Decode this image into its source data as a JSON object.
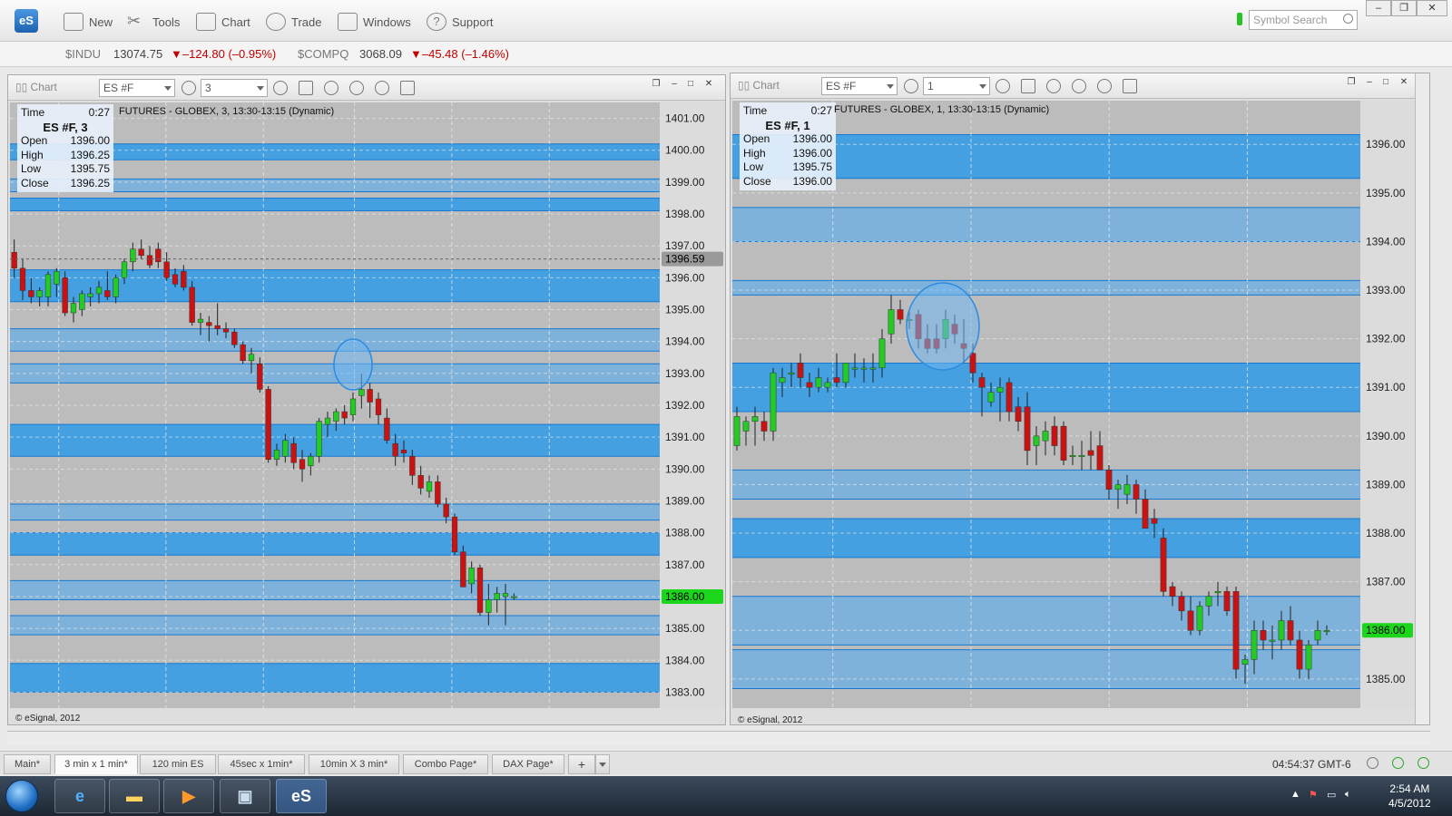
{
  "app": {
    "logo": "eS",
    "toolbar": [
      {
        "label": "New",
        "icon": "new-window-icon"
      },
      {
        "label": "Tools",
        "icon": "tools-icon"
      },
      {
        "label": "Chart",
        "icon": "chart-icon"
      },
      {
        "label": "Trade",
        "icon": "trade-icon"
      },
      {
        "label": "Windows",
        "icon": "windows-icon"
      },
      {
        "label": "Support",
        "icon": "help-icon"
      }
    ],
    "symbol_search_placeholder": "Symbol Search",
    "window_controls": [
      "–",
      "❐",
      "✕"
    ]
  },
  "ticker": [
    {
      "symbol": "$INDU",
      "value": "13074.75",
      "change": "▼–124.80 (–0.95%)"
    },
    {
      "symbol": "$COMPQ",
      "value": "3068.09",
      "change": "▼–45.48 (–1.46%)"
    }
  ],
  "colors": {
    "up": "#22cc22",
    "down": "#cc1111",
    "band_dark": "#2f9be6",
    "band_light": "#74b0df",
    "bg": "#bcbcbc",
    "last_price_bg": "#1cd61c"
  },
  "panes": [
    {
      "title": "Chart",
      "symbol": "ES #F",
      "interval": "3",
      "subtitle": "FUTURES - GLOBEX, 3, 13:30-13:15 (Dynamic)",
      "info": {
        "time_label": "Time",
        "time": "0:27",
        "header": "ES #F, 3",
        "rows": [
          [
            "Open",
            "1396.00"
          ],
          [
            "High",
            "1396.25"
          ],
          [
            "Low",
            "1395.75"
          ],
          [
            "Close",
            "1396.25"
          ]
        ]
      },
      "copyright": "© eSignal, 2012",
      "axis_labels": [
        "1401.00",
        "1400.00",
        "1399.00",
        "1398.00",
        "1397.00",
        "1396.00",
        "1395.00",
        "1394.00",
        "1393.00",
        "1392.00",
        "1391.00",
        "1390.00",
        "1389.00",
        "1388.00",
        "1387.00",
        "1386.00",
        "1385.00",
        "1384.00",
        "1383.00"
      ],
      "marker_label": "1396.59",
      "last_price": "1386.00"
    },
    {
      "title": "Chart",
      "symbol": "ES #F",
      "interval": "1",
      "subtitle": "FUTURES - GLOBEX, 1, 13:30-13:15 (Dynamic)",
      "info": {
        "time_label": "Time",
        "time": "0:27",
        "header": "ES #F, 1",
        "rows": [
          [
            "Open",
            "1396.00"
          ],
          [
            "High",
            "1396.00"
          ],
          [
            "Low",
            "1395.75"
          ],
          [
            "Close",
            "1396.00"
          ]
        ]
      },
      "copyright": "© eSignal, 2012",
      "axis_labels": [
        "1396.00",
        "1395.00",
        "1394.00",
        "1393.00",
        "1392.00",
        "1391.00",
        "1390.00",
        "1389.00",
        "1388.00",
        "1387.00",
        "1386.00",
        "1385.00"
      ],
      "last_price": "1386.00"
    }
  ],
  "tabs": [
    {
      "label": "Main*"
    },
    {
      "label": "3 min x 1 min*",
      "active": true
    },
    {
      "label": "120 min ES"
    },
    {
      "label": "45sec x 1min*"
    },
    {
      "label": "10min X 3 min*"
    },
    {
      "label": "Combo Page*"
    },
    {
      "label": "DAX Page*"
    },
    {
      "label": "+"
    }
  ],
  "status": {
    "clock": "04:54:37 GMT-6"
  },
  "taskbar": {
    "time": "2:54 AM",
    "date": "4/5/2012"
  },
  "chart_data": [
    {
      "type": "candlestick",
      "title": "ES #F, 3",
      "ylim": [
        1382.5,
        1401.5
      ],
      "candles": [
        [
          1396.8,
          1397.2,
          1396.0,
          1396.3
        ],
        [
          1396.3,
          1396.6,
          1395.3,
          1395.6
        ],
        [
          1395.6,
          1396.0,
          1395.2,
          1395.4
        ],
        [
          1395.4,
          1395.7,
          1395.1,
          1395.6
        ],
        [
          1395.4,
          1396.2,
          1395.1,
          1396.1
        ],
        [
          1395.8,
          1396.3,
          1395.4,
          1396.2
        ],
        [
          1396.0,
          1396.2,
          1394.8,
          1394.9
        ],
        [
          1394.9,
          1395.4,
          1394.6,
          1395.2
        ],
        [
          1395.0,
          1395.6,
          1394.8,
          1395.5
        ],
        [
          1395.4,
          1395.7,
          1395.1,
          1395.5
        ],
        [
          1395.5,
          1395.9,
          1395.2,
          1395.7
        ],
        [
          1395.6,
          1396.2,
          1395.3,
          1395.4
        ],
        [
          1395.4,
          1396.1,
          1395.2,
          1396.0
        ],
        [
          1396.0,
          1396.6,
          1395.8,
          1396.5
        ],
        [
          1396.5,
          1397.1,
          1396.2,
          1396.9
        ],
        [
          1396.9,
          1397.2,
          1396.6,
          1396.7
        ],
        [
          1396.7,
          1397.0,
          1396.3,
          1396.4
        ],
        [
          1396.9,
          1397.1,
          1396.3,
          1396.5
        ],
        [
          1396.5,
          1396.8,
          1395.9,
          1396.0
        ],
        [
          1396.1,
          1396.3,
          1395.7,
          1395.8
        ],
        [
          1396.2,
          1396.4,
          1395.6,
          1395.7
        ],
        [
          1395.7,
          1395.9,
          1394.5,
          1394.6
        ],
        [
          1394.6,
          1394.9,
          1394.2,
          1394.7
        ],
        [
          1394.6,
          1394.8,
          1394.0,
          1394.5
        ],
        [
          1394.5,
          1395.2,
          1394.2,
          1394.4
        ],
        [
          1394.4,
          1394.6,
          1394.1,
          1394.3
        ],
        [
          1394.3,
          1394.4,
          1393.8,
          1393.9
        ],
        [
          1393.9,
          1394.0,
          1393.3,
          1393.4
        ],
        [
          1393.4,
          1393.8,
          1393.0,
          1393.6
        ],
        [
          1393.3,
          1393.5,
          1392.4,
          1392.5
        ],
        [
          1392.5,
          1392.6,
          1390.2,
          1390.3
        ],
        [
          1390.3,
          1390.8,
          1390.1,
          1390.6
        ],
        [
          1390.4,
          1391.1,
          1390.2,
          1390.9
        ],
        [
          1390.8,
          1391.0,
          1390.0,
          1390.2
        ],
        [
          1390.3,
          1390.6,
          1389.6,
          1390.0
        ],
        [
          1390.1,
          1390.5,
          1389.8,
          1390.4
        ],
        [
          1390.4,
          1391.6,
          1390.2,
          1391.5
        ],
        [
          1391.4,
          1391.8,
          1391.0,
          1391.6
        ],
        [
          1391.5,
          1391.9,
          1391.2,
          1391.8
        ],
        [
          1391.8,
          1392.0,
          1391.4,
          1391.6
        ],
        [
          1391.7,
          1392.4,
          1391.5,
          1392.2
        ],
        [
          1392.3,
          1393.0,
          1391.9,
          1392.5
        ],
        [
          1392.5,
          1392.7,
          1391.6,
          1392.1
        ],
        [
          1392.2,
          1392.4,
          1391.4,
          1391.7
        ],
        [
          1391.6,
          1391.9,
          1390.8,
          1390.9
        ],
        [
          1390.8,
          1391.1,
          1390.1,
          1390.4
        ],
        [
          1390.6,
          1390.9,
          1390.2,
          1390.5
        ],
        [
          1390.4,
          1390.6,
          1389.5,
          1389.8
        ],
        [
          1389.8,
          1390.1,
          1389.2,
          1389.4
        ],
        [
          1389.3,
          1389.8,
          1389.1,
          1389.6
        ],
        [
          1389.6,
          1389.8,
          1388.8,
          1388.9
        ],
        [
          1388.9,
          1389.1,
          1388.3,
          1388.5
        ],
        [
          1388.5,
          1388.6,
          1387.3,
          1387.4
        ],
        [
          1387.4,
          1387.6,
          1386.3,
          1386.3
        ],
        [
          1386.4,
          1387.1,
          1386.1,
          1386.9
        ],
        [
          1386.9,
          1387.0,
          1385.4,
          1385.5
        ],
        [
          1385.5,
          1386.4,
          1385.1,
          1385.9
        ],
        [
          1385.9,
          1386.3,
          1385.5,
          1386.1
        ],
        [
          1386.0,
          1386.4,
          1385.1,
          1386.1
        ],
        [
          1386.0,
          1386.1,
          1385.9,
          1386.0
        ]
      ]
    },
    {
      "type": "candlestick",
      "title": "ES #F, 1",
      "ylim": [
        1384.4,
        1396.9
      ],
      "candles": [
        [
          1389.8,
          1390.6,
          1389.7,
          1390.4
        ],
        [
          1390.1,
          1390.4,
          1389.8,
          1390.3
        ],
        [
          1390.3,
          1390.6,
          1389.8,
          1390.4
        ],
        [
          1390.3,
          1390.5,
          1389.9,
          1390.1
        ],
        [
          1390.1,
          1391.4,
          1389.9,
          1391.3
        ],
        [
          1391.1,
          1391.4,
          1390.8,
          1391.2
        ],
        [
          1391.3,
          1391.5,
          1391.0,
          1391.3
        ],
        [
          1391.5,
          1391.7,
          1391.0,
          1391.2
        ],
        [
          1391.1,
          1391.3,
          1390.8,
          1391.0
        ],
        [
          1391.0,
          1391.4,
          1390.9,
          1391.2
        ],
        [
          1391.0,
          1391.2,
          1390.9,
          1391.1
        ],
        [
          1391.2,
          1391.7,
          1391.0,
          1391.1
        ],
        [
          1391.1,
          1391.5,
          1391.0,
          1391.5
        ],
        [
          1391.4,
          1391.7,
          1391.2,
          1391.4
        ],
        [
          1391.4,
          1391.6,
          1391.1,
          1391.4
        ],
        [
          1391.4,
          1391.7,
          1391.1,
          1391.4
        ],
        [
          1391.4,
          1392.2,
          1391.2,
          1392.0
        ],
        [
          1392.1,
          1392.9,
          1391.9,
          1392.6
        ],
        [
          1392.6,
          1392.8,
          1392.3,
          1392.4
        ],
        [
          1392.4,
          1392.6,
          1392.2,
          1392.4
        ],
        [
          1392.5,
          1392.6,
          1391.8,
          1392.0
        ],
        [
          1392.0,
          1392.3,
          1391.7,
          1391.8
        ],
        [
          1392.0,
          1392.3,
          1391.7,
          1391.8
        ],
        [
          1392.0,
          1392.6,
          1391.8,
          1392.4
        ],
        [
          1392.3,
          1392.5,
          1391.9,
          1392.1
        ],
        [
          1391.9,
          1392.4,
          1391.5,
          1391.8
        ],
        [
          1391.7,
          1391.9,
          1391.1,
          1391.3
        ],
        [
          1391.2,
          1391.3,
          1390.4,
          1391.0
        ],
        [
          1390.7,
          1391.1,
          1390.6,
          1390.9
        ],
        [
          1390.9,
          1391.2,
          1390.3,
          1391.0
        ],
        [
          1391.1,
          1391.2,
          1390.3,
          1390.5
        ],
        [
          1390.6,
          1390.8,
          1390.1,
          1390.3
        ],
        [
          1390.6,
          1390.9,
          1389.4,
          1389.7
        ],
        [
          1389.8,
          1390.2,
          1389.4,
          1390.0
        ],
        [
          1389.9,
          1390.3,
          1389.6,
          1390.1
        ],
        [
          1390.2,
          1390.4,
          1389.6,
          1389.8
        ],
        [
          1390.2,
          1390.3,
          1389.4,
          1389.5
        ],
        [
          1389.6,
          1389.8,
          1389.4,
          1389.6
        ],
        [
          1389.6,
          1389.9,
          1389.3,
          1389.6
        ],
        [
          1389.7,
          1390.1,
          1389.3,
          1389.6
        ],
        [
          1389.8,
          1390.1,
          1389.3,
          1389.3
        ],
        [
          1389.3,
          1389.4,
          1388.7,
          1388.9
        ],
        [
          1388.9,
          1389.1,
          1388.5,
          1389.0
        ],
        [
          1388.8,
          1389.2,
          1388.6,
          1389.0
        ],
        [
          1389.0,
          1389.1,
          1388.4,
          1388.7
        ],
        [
          1388.7,
          1388.9,
          1388.1,
          1388.1
        ],
        [
          1388.3,
          1388.5,
          1387.9,
          1388.2
        ],
        [
          1387.9,
          1388.1,
          1386.7,
          1386.8
        ],
        [
          1386.9,
          1387.0,
          1386.5,
          1386.7
        ],
        [
          1386.7,
          1386.8,
          1386.2,
          1386.4
        ],
        [
          1386.4,
          1386.7,
          1385.9,
          1386.0
        ],
        [
          1386.0,
          1386.6,
          1385.9,
          1386.5
        ],
        [
          1386.5,
          1386.8,
          1386.3,
          1386.7
        ],
        [
          1386.8,
          1387.0,
          1386.5,
          1386.8
        ],
        [
          1386.8,
          1386.9,
          1386.3,
          1386.4
        ],
        [
          1386.8,
          1386.9,
          1385.0,
          1385.2
        ],
        [
          1385.3,
          1385.5,
          1384.9,
          1385.4
        ],
        [
          1385.4,
          1386.2,
          1385.1,
          1386.0
        ],
        [
          1386.0,
          1386.2,
          1385.6,
          1385.8
        ],
        [
          1385.8,
          1386.1,
          1385.4,
          1385.8
        ],
        [
          1385.8,
          1386.4,
          1385.6,
          1386.2
        ],
        [
          1386.2,
          1386.5,
          1385.7,
          1385.8
        ],
        [
          1385.8,
          1386.0,
          1385.0,
          1385.2
        ],
        [
          1385.2,
          1385.8,
          1385.0,
          1385.7
        ],
        [
          1385.8,
          1386.2,
          1385.7,
          1386.0
        ],
        [
          1386.0,
          1386.1,
          1385.9,
          1386.0
        ]
      ]
    }
  ]
}
